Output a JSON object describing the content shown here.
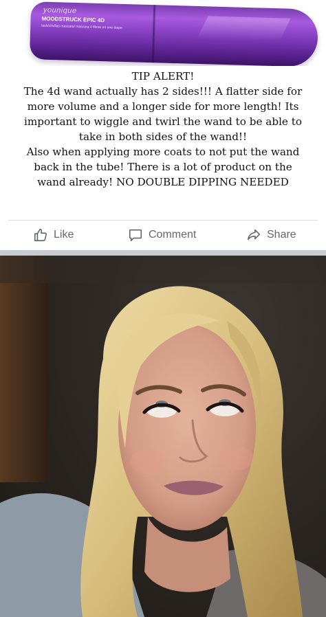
{
  "product_image": {
    "brand": "younique",
    "product_name": "MOODSTRUCK EPIC 4D",
    "fine_print": "lash/cils/llas mascara/ mascara 4 fibras en une étape",
    "colors": {
      "tube": "#8a43c6",
      "tube_dark": "#3e1466"
    }
  },
  "post_text": {
    "lines": [
      "TIP ALERT!",
      "The 4d wand actually has 2 sides!!! A flatter side for",
      "more volume and a longer side for more length! Its",
      "important to wiggle and twirl the wand to be able to",
      "take in both sides of the wand!!",
      "Also when applying more coats to not put the wand",
      "back in the tube! There is a lot of product on the",
      "wand already! NO DOUBLE DIPPING NEEDED"
    ]
  },
  "actions": {
    "like": "Like",
    "comment": "Comment",
    "share": "Share"
  },
  "photo": {
    "icon": "woman-eye-roll-photo",
    "colors": {
      "hair": "#d9c07e",
      "skin": "#d9a48d",
      "shirt": "#8e9aa6"
    }
  }
}
